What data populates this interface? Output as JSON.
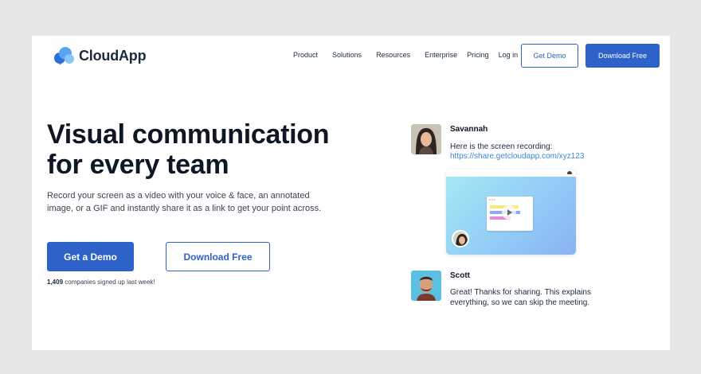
{
  "brand": {
    "name": "CloudApp",
    "logo_colors": [
      "#2c6fd8",
      "#57a4f0",
      "#87c6f7"
    ]
  },
  "nav": {
    "items": [
      "Product",
      "Solutions",
      "Resources",
      "Enterprise",
      "Pricing",
      "Log in"
    ],
    "get_demo": "Get Demo",
    "download_free": "Download Free"
  },
  "hero": {
    "headline_line1": "Visual communication",
    "headline_line2": "for every team",
    "subcopy": "Record your screen as a video with your voice & face, an annotated image, or a GIF and instantly share it as a link to get your point across.",
    "cta_primary": "Get a Demo",
    "cta_secondary": "Download Free",
    "signup_count": "1,409",
    "signup_text": " companies signed up last week!"
  },
  "chat": {
    "messages": [
      {
        "name": "Savannah",
        "text": "Here is the screen recording:",
        "link": "https://share.getcloudapp.com/xyz123"
      },
      {
        "name": "Scott",
        "text_line1": "Great! Thanks for sharing. This explains",
        "text_line2": "everything, so we can skip the meeting."
      }
    ],
    "video_icon": "play-icon"
  },
  "colors": {
    "accent": "#2d63c8",
    "link": "#3a87d9",
    "text_dark": "#0e1726",
    "backdrop": "#e6e6e6"
  }
}
